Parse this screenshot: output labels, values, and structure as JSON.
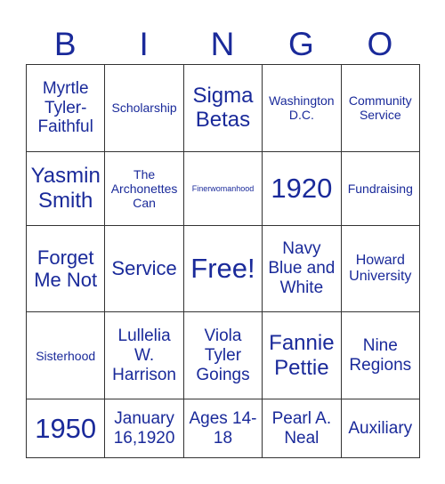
{
  "header": {
    "letters": [
      "B",
      "I",
      "N",
      "G",
      "O"
    ]
  },
  "grid": [
    [
      {
        "text": "Myrtle Tyler-Faithful",
        "size": "l"
      },
      {
        "text": "Scholarship",
        "size": "s"
      },
      {
        "text": "Sigma Betas",
        "size": "xxl"
      },
      {
        "text": "Washington D.C.",
        "size": "s"
      },
      {
        "text": "Community Service",
        "size": "s"
      }
    ],
    [
      {
        "text": "Yasmin Smith",
        "size": "xxl"
      },
      {
        "text": "The Archonettes Can",
        "size": "s"
      },
      {
        "text": "Finerwomanhood",
        "size": "xs"
      },
      {
        "text": "1920",
        "size": "big"
      },
      {
        "text": "Fundraising",
        "size": "s"
      }
    ],
    [
      {
        "text": "Forget Me Not",
        "size": "xl"
      },
      {
        "text": "Service",
        "size": "xl"
      },
      {
        "text": "Free!",
        "size": "big"
      },
      {
        "text": "Navy Blue and White",
        "size": "l"
      },
      {
        "text": "Howard University",
        "size": "m"
      }
    ],
    [
      {
        "text": "Sisterhood",
        "size": "s"
      },
      {
        "text": "Lullelia W. Harrison",
        "size": "l"
      },
      {
        "text": "Viola Tyler Goings",
        "size": "l"
      },
      {
        "text": "Fannie Pettie",
        "size": "xxl"
      },
      {
        "text": "Nine Regions",
        "size": "l"
      }
    ],
    [
      {
        "text": "1950",
        "size": "big"
      },
      {
        "text": "January 16,1920",
        "size": "l"
      },
      {
        "text": "Ages 14-18",
        "size": "l",
        "low": true
      },
      {
        "text": "Pearl A. Neal",
        "size": "l"
      },
      {
        "text": "Auxiliary",
        "size": "l"
      }
    ]
  ]
}
